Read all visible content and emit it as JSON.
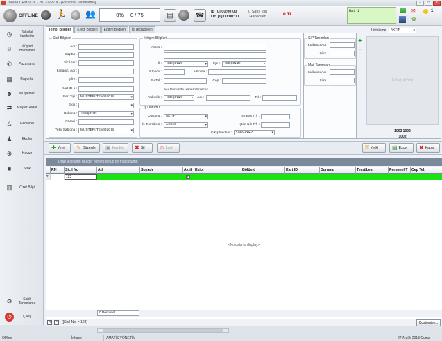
{
  "window": {
    "title": "İnkaso CRM V 2L - 20131227.a - [Personel Tanımlama]"
  },
  "toolbar": {
    "status": "OFFLINE",
    "counter_percent": "0%",
    "counter_value": "0 / 75",
    "timer_ib": "IB [0] 00:00:00",
    "timer_ob": "OB [0] 00:00:00",
    "satis_label_1": "0 Satış İçin",
    "satis_label_2": "Hakedilen",
    "amount": "0 TL",
    "chat_text": "Hat 1",
    "notif_count": "1"
  },
  "sidebar": {
    "items": [
      {
        "label": "Tahsilat Hareketleri",
        "icon": "clock-icon"
      },
      {
        "label": "Müşteri Hizmetleri",
        "icon": "customer-service-icon"
      },
      {
        "label": "Pazarlama",
        "icon": "phone-icon"
      },
      {
        "label": "Raporlar",
        "icon": "report-icon"
      },
      {
        "label": "Müşteriler",
        "icon": "customers-icon"
      },
      {
        "label": "Müşteri Aktar",
        "icon": "transfer-icon"
      },
      {
        "label": "Personel",
        "icon": "person-icon"
      },
      {
        "label": "Ekipler",
        "icon": "team-icon"
      },
      {
        "label": "Havuz",
        "icon": "pool-icon"
      },
      {
        "label": "Stok",
        "icon": "stock-icon"
      },
      {
        "label": "Özet Bilgi",
        "icon": "summary-icon"
      },
      {
        "label": "Sabit Tanımlama",
        "icon": "settings-icon"
      },
      {
        "label": "Çıkış",
        "icon": "power-icon"
      }
    ]
  },
  "tabs": [
    "Temel Bilgiler",
    "Kredi Bilgileri",
    "Eğitim Bilgileri",
    "İş Tecrübeleri"
  ],
  "sicil": {
    "title": "Sicil Bilgileri",
    "labels": {
      "adi": "Adı :",
      "soyadi": "Soyadı :",
      "sicil_no": "Sicil No :",
      "kullanici": "Kullanıcı Adı :",
      "sifre": "Şifre :",
      "kart_id": "Kart ID 1 :",
      "per_tipi": "Per. Tipi :",
      "ekip": "Ekip :",
      "bolumu": "Bölümü :",
      "gorevi": "Görevi :",
      "yetki": "Yetki Şablonu :"
    },
    "values": {
      "per_tipi": "MÜŞTERİ TEMSİLCİSİ",
      "bolumu": "<SEÇİNİZ>",
      "yetki": "MÜŞTERİ TEMSİLCİSİ"
    }
  },
  "iletisim": {
    "title": "İletişim Bilgileri",
    "labels": {
      "adres": "Adres :",
      "il": "İl :",
      "ilce": "İlçe :",
      "pkodu": "P.Kodu :",
      "eposta": "e-Posta :",
      "evtel": "Ev Tel :",
      "cep": "Cep :",
      "acil_title": "Acil Durumda Haber Verilecek",
      "yakinlik": "Yakınlık :",
      "acil_adi": "Adı :",
      "tel": "Tel :"
    },
    "values": {
      "il": "<SEÇİNİZ>",
      "ilce": "<SEÇİNİZ>",
      "yakinlik": "<SEÇİNİZ>"
    }
  },
  "isdurumu": {
    "title": "İş Durumu",
    "labels": {
      "durumu": "Durumu :",
      "tecrubesi": "İş Tecrübesi :",
      "ise_bas": "İşe Baş Trh :",
      "isten_cik": "İşten Çık Trh :",
      "cikis_nedeni": "Çıkış Nedeni :"
    },
    "values": {
      "durumu": "AKTİF",
      "tecrubesi": "ACEMİ",
      "cikis_nedeni": "<SEÇİNİZ>"
    }
  },
  "sip": {
    "title": "SIP Tanımları",
    "kullanici": "Kullanıcı Adı :",
    "sifre": "Şifre :"
  },
  "mail": {
    "title": "Mail Tanımları",
    "kullanici": "Kullanıcı Adı :",
    "sifre": "Şifre :"
  },
  "photo": {
    "listeleme_label": "Listeleme",
    "listeleme_value": "AKTİF",
    "placeholder": "Fotoğraf Yok",
    "code_line1": "1002 1002",
    "code_line2": "1002"
  },
  "actions": {
    "yeni": "Yeni",
    "duzenle": "Düzenle",
    "kaydet": "Kaydet",
    "sil": "Sil",
    "iptal": "İptal",
    "yetki": "Yetki",
    "excel": "Excel",
    "kapat": "Kapat"
  },
  "grid": {
    "group_hint": "Drag a column header here to group by that column",
    "columns": [
      "RN",
      "Sicil No",
      "Adı",
      "Soyadı",
      "Aktif",
      "Ekibi",
      "Bölümü",
      "Kart ID",
      "Durumu",
      "Tecrübesi",
      "Personel T",
      "Cep Tel."
    ],
    "filter_sicil": "123",
    "no_data": "<No data to display>",
    "summary": "0 Personel",
    "filter_text": "([Sicil No] = 123)",
    "customize": "Customize..."
  },
  "statusbar": {
    "mode": "Offline",
    "company": "İnkaso",
    "user": "AMATİS YÖNETİM",
    "date": "27 Aralık 2013 Cuma"
  }
}
